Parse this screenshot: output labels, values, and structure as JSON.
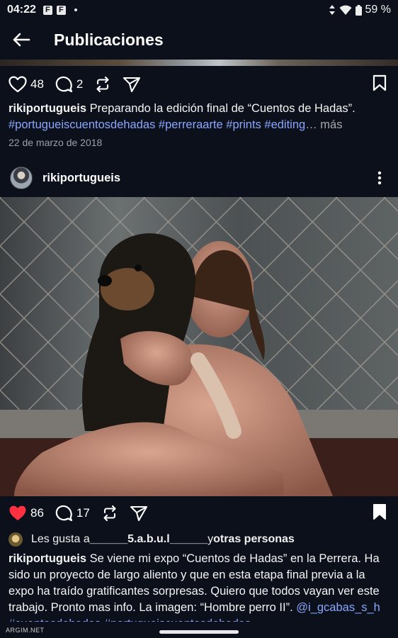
{
  "status_bar": {
    "time": "04:22",
    "notif_icons": [
      "F",
      "F"
    ],
    "battery": "59 %"
  },
  "header": {
    "title": "Publicaciones"
  },
  "post1": {
    "likes": "48",
    "comments": "2",
    "caption_user": "rikiportugueis",
    "caption_text": " Preparando la edición final de “Cuentos de Hadas”.",
    "hashtags": "#portugueiscuentosdehadas #perreraarte #prints #editing",
    "more": "… más",
    "date": "22 de marzo de 2018"
  },
  "post2": {
    "username": "rikiportugueis",
    "likes": "86",
    "comments": "17",
    "liked_by_prefix": "Les gusta a ",
    "liked_by_user": "______5.a.b.u.l______",
    "liked_by_mid": " y ",
    "liked_by_others": "otras personas",
    "caption_user": "rikiportugueis",
    "caption_text": " Se viene mi expo “Cuentos de Hadas” en la Perrera. Ha sido un proyecto de largo aliento y que en esta etapa final previa a la expo ha traído gratificantes sorpresas. Quiero que todos vayan ver este trabajo. Pronto mas info. La imagen: “Hombre perro II”.",
    "hashtags_partial": "@i_gcabas_s_h #cuentosdehadas #portugueiscuentosdehadas"
  },
  "watermark": "ARGIM.NET",
  "colors": {
    "background": "#0b101a",
    "hashtag": "#8aa6ff",
    "liked_heart": "#ff3040"
  }
}
